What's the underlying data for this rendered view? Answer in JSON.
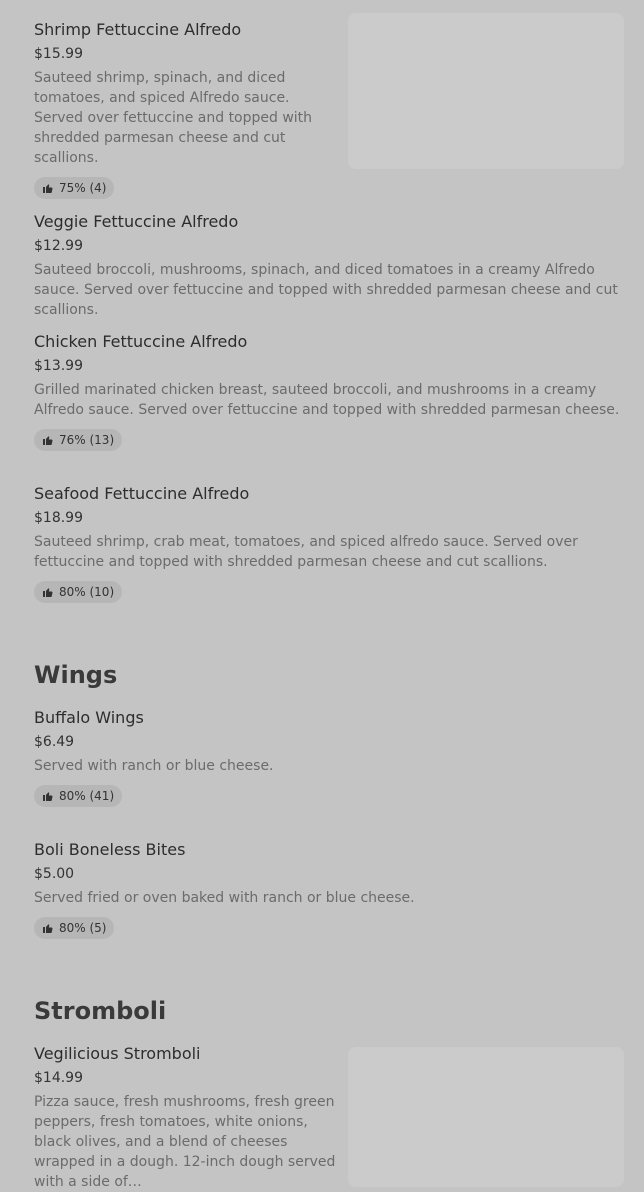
{
  "sections": [
    {
      "items": [
        {
          "name": "Shrimp Fettuccine Alfredo",
          "price": "$15.99",
          "desc": "Sauteed shrimp, spinach, and diced tomatoes, and spiced Alfredo sauce. Served over fettuccine and topped with shredded parmesan cheese and cut scallions.",
          "rating": "75% (4)"
        },
        {
          "name": "Veggie Fettuccine Alfredo",
          "price": "$12.99",
          "desc": "Sauteed broccoli, mushrooms, spinach, and diced tomatoes in a creamy Alfredo sauce. Served over fettuccine and topped with shredded parmesan cheese and cut scallions."
        },
        {
          "name": "Chicken Fettuccine Alfredo",
          "price": "$13.99",
          "desc": "Grilled marinated chicken breast, sauteed broccoli, and mushrooms in a creamy Alfredo sauce. Served over fettuccine and topped with shredded parmesan cheese.",
          "rating": "76% (13)"
        },
        {
          "name": "Seafood Fettuccine Alfredo",
          "price": "$18.99",
          "desc": "Sauteed shrimp, crab meat, tomatoes, and spiced alfredo sauce. Served over fettuccine and topped with shredded parmesan cheese and cut scallions.",
          "rating": "80% (10)"
        }
      ]
    },
    {
      "title": "Wings",
      "items": [
        {
          "name": "Buffalo Wings",
          "price": "$6.49",
          "desc": "Served with ranch or blue cheese.",
          "rating": "80% (41)"
        },
        {
          "name": "Boli Boneless Bites",
          "price": "$5.00",
          "desc": "Served fried or oven baked with ranch or blue cheese.",
          "rating": "80% (5)"
        }
      ]
    },
    {
      "title": "Stromboli",
      "items": [
        {
          "name": "Vegilicious Stromboli",
          "price": "$14.99",
          "desc": "Pizza sauce, fresh mushrooms, fresh green peppers, fresh tomatoes, white onions, black olives, and a blend of cheeses wrapped in a dough. 12-inch dough served with a side of…"
        }
      ]
    }
  ],
  "icons": {
    "thumb": "thumbs-up-icon"
  }
}
